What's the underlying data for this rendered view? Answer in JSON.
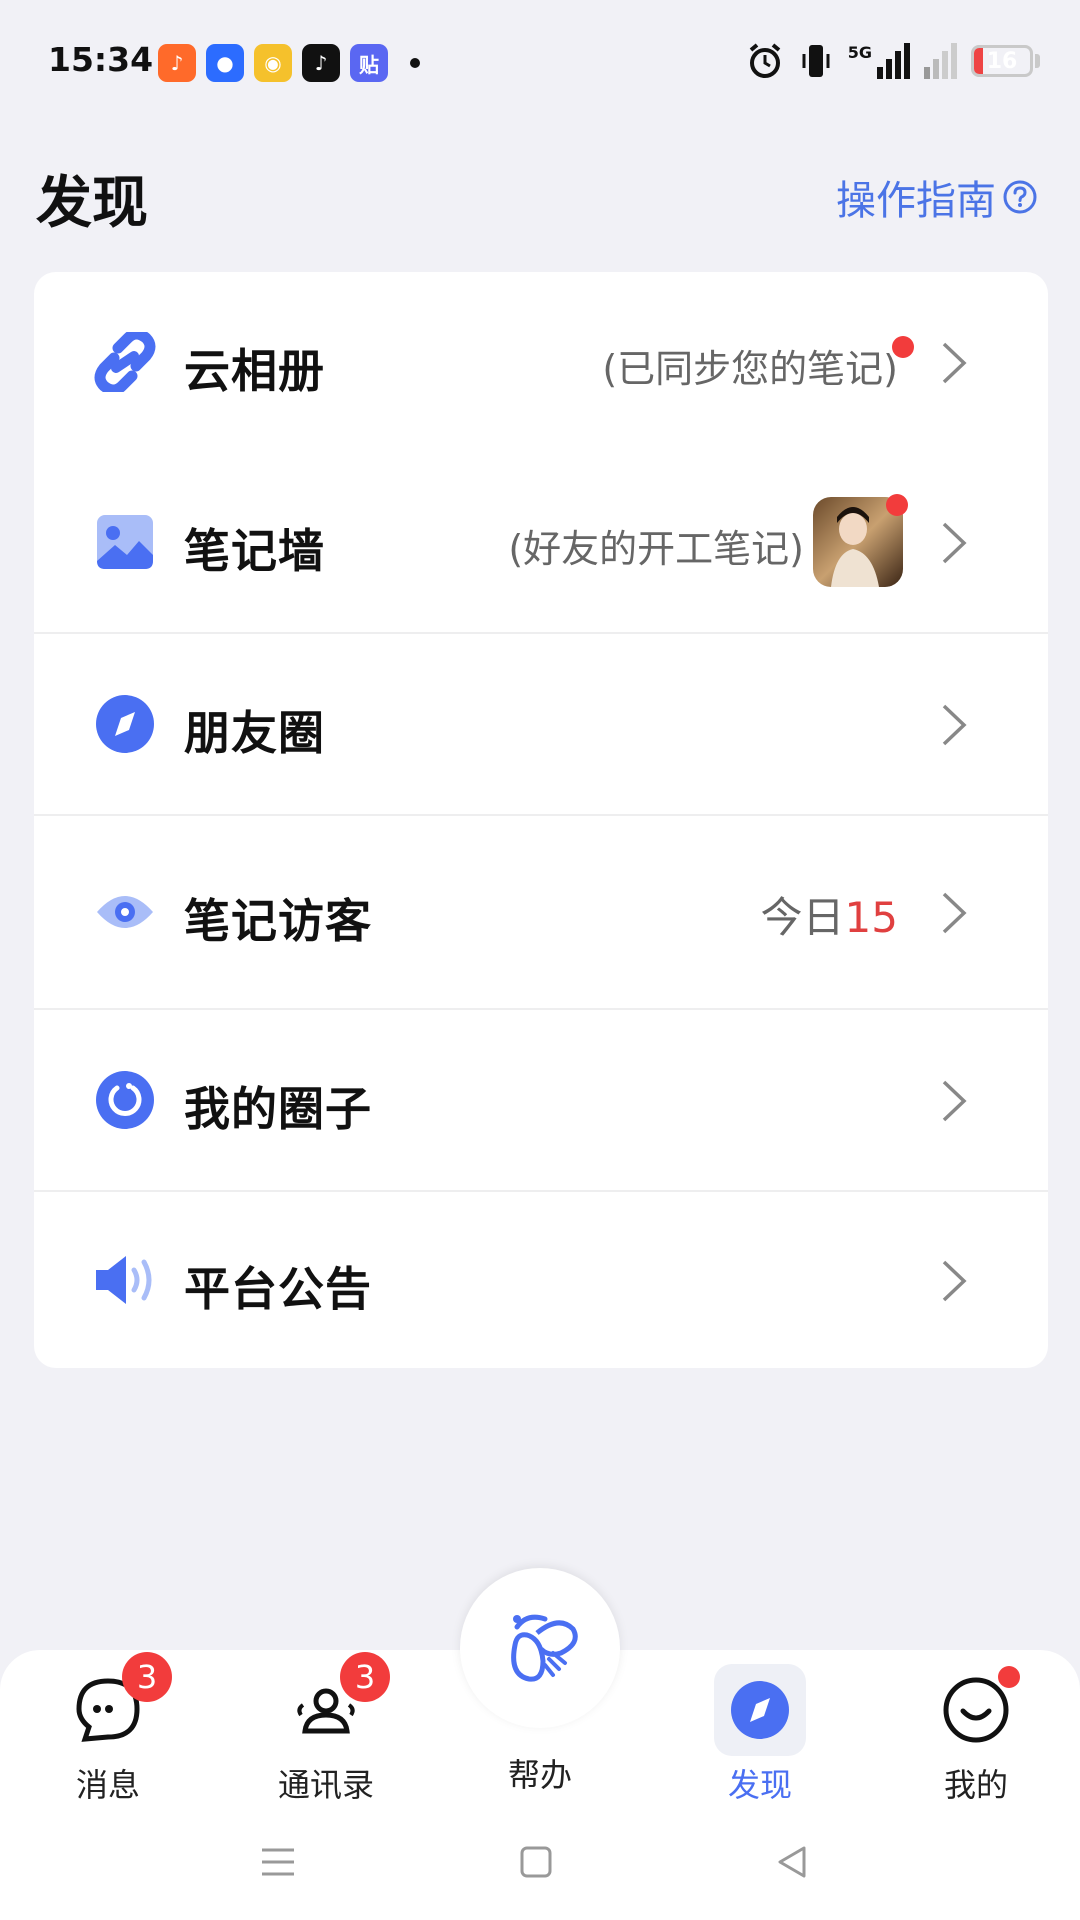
{
  "status_bar": {
    "time": "15:34",
    "app_icons": [
      {
        "name": "kuaishou-app-icon",
        "glyph": "♪",
        "color": "#ff6a2a"
      },
      {
        "name": "alipay-app-icon",
        "glyph": "●",
        "color": "#2c6cff"
      },
      {
        "name": "weibo-app-icon",
        "glyph": "◉",
        "color": "#f5c12c"
      },
      {
        "name": "douyin-app-icon",
        "glyph": "♪",
        "color": "#111111"
      },
      {
        "name": "tieba-app-icon",
        "glyph": "贴",
        "color": "#5a67f2"
      }
    ],
    "network": "5G",
    "battery": "16",
    "battery_level": 0.16
  },
  "header": {
    "title": "发现",
    "guide_label": "操作指南"
  },
  "menu": {
    "cloud_album": {
      "label": "云相册",
      "hint": "(已同步您的笔记)"
    },
    "note_wall": {
      "label": "笔记墙",
      "hint": "(好友的开工笔记)"
    },
    "moments": {
      "label": "朋友圈"
    },
    "note_visitors": {
      "label": "笔记访客",
      "hint_prefix": "今日",
      "count": "15"
    },
    "my_circles": {
      "label": "我的圈子"
    },
    "announcements": {
      "label": "平台公告"
    }
  },
  "bottom_nav": {
    "messages": {
      "label": "消息",
      "badge": "3"
    },
    "contacts": {
      "label": "通讯录",
      "badge": "3"
    },
    "help": {
      "label": "帮办"
    },
    "discover": {
      "label": "发现"
    },
    "me": {
      "label": "我的"
    }
  },
  "colors": {
    "accent": "#4b74e6",
    "icon_blue": "#4a6ff2",
    "badge_red": "#f23c3c",
    "count_red": "#e04040"
  }
}
